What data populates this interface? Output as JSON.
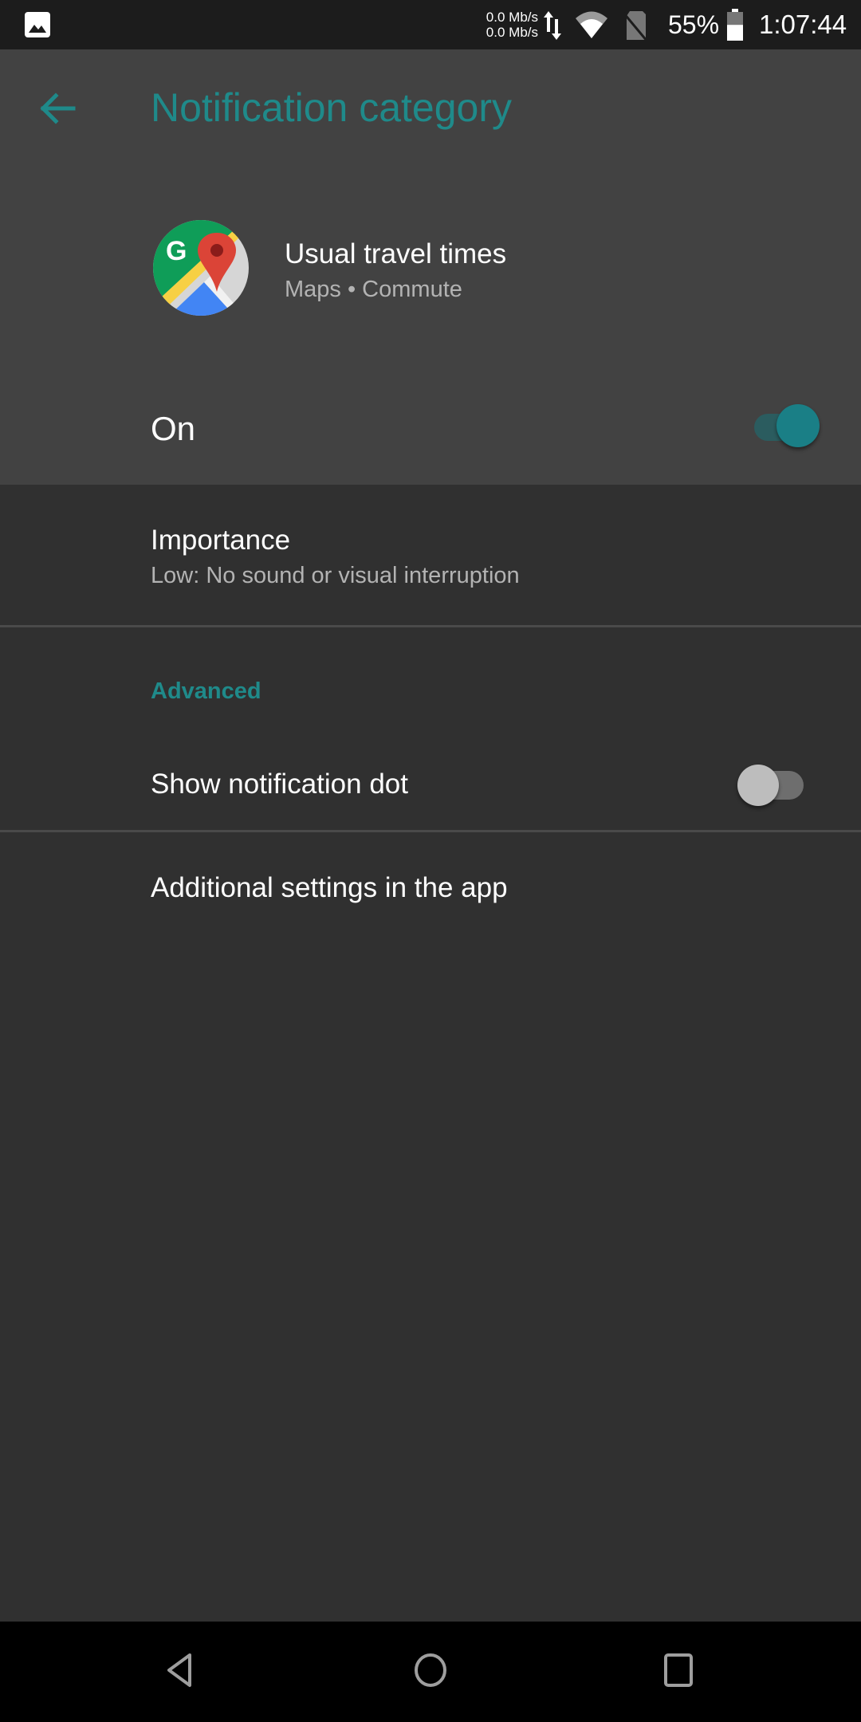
{
  "status_bar": {
    "notification_icon": "image-icon",
    "upload_speed": "0.0 Mb/s",
    "download_speed": "0.0 Mb/s",
    "data_activity_icon": "data-arrows-icon",
    "wifi_icon": "wifi-icon",
    "sim_icon": "no-sim-icon",
    "battery_percent": "55%",
    "battery_level": 0.55,
    "time": "1:07:44"
  },
  "header": {
    "back_icon": "arrow-back-icon",
    "title": "Notification category"
  },
  "app": {
    "icon": "google-maps-icon",
    "channel_name": "Usual travel times",
    "channel_subtitle": "Maps • Commute"
  },
  "master_switch": {
    "label": "On",
    "checked": true,
    "accent_color": "#1a7f86"
  },
  "settings": {
    "importance": {
      "title": "Importance",
      "summary": "Low: No sound or visual interruption"
    },
    "advanced_header": "Advanced",
    "notification_dot": {
      "title": "Show notification dot",
      "checked": false
    },
    "additional": {
      "title": "Additional settings in the app"
    }
  },
  "nav_bar": {
    "back": "nav-back-icon",
    "home": "nav-home-icon",
    "recents": "nav-recents-icon"
  },
  "colors": {
    "accent": "#1f8a8a",
    "header_bg": "#424242",
    "body_bg": "#303030"
  }
}
